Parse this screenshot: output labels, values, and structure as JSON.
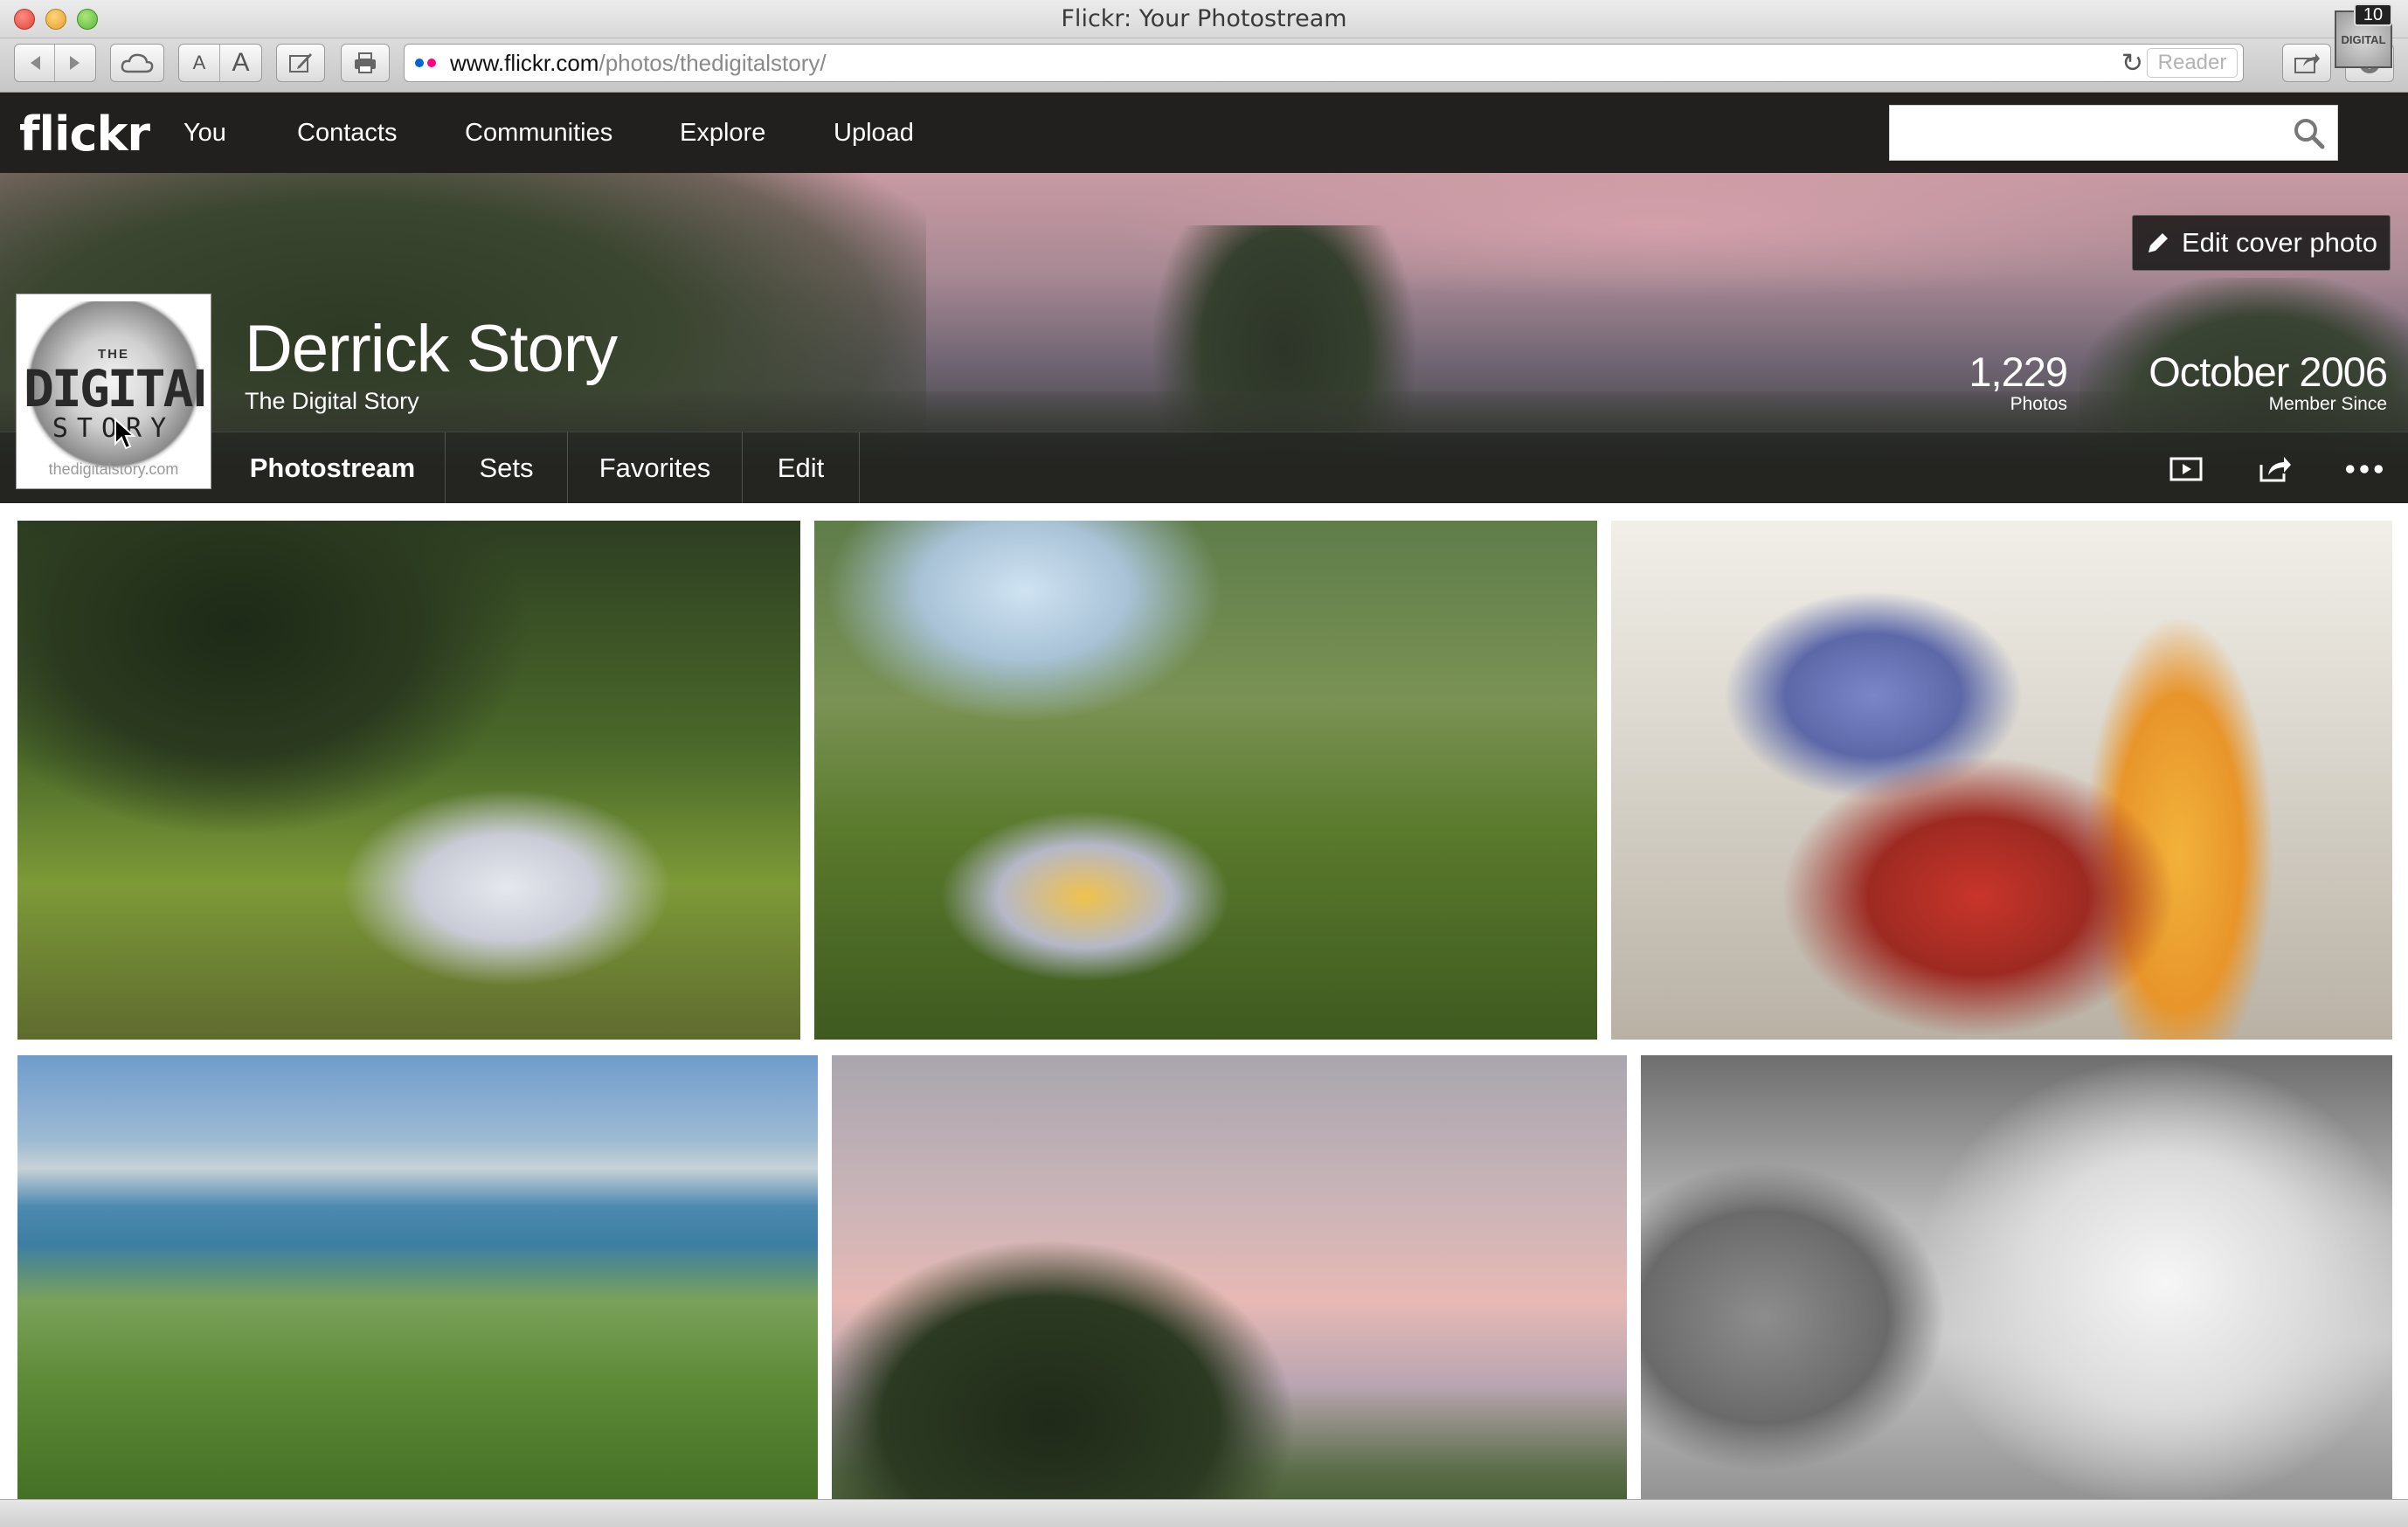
{
  "window": {
    "title": "Flickr: Your Photostream"
  },
  "browser": {
    "url_host": "www.flickr.com",
    "url_path": "/photos/thedigitalstory/",
    "reader_label": "Reader",
    "font_small": "A",
    "font_large": "A"
  },
  "nav": {
    "logo": "flickr",
    "links": [
      "You",
      "Contacts",
      "Communities",
      "Explore",
      "Upload"
    ],
    "search_placeholder": "",
    "notification_count": "10",
    "avatar_text": "DIGITAL"
  },
  "profile": {
    "name": "Derrick Story",
    "subtitle": "The Digital Story",
    "avatar": {
      "the": "THE",
      "digital": "DIGITAL",
      "story": "STORY",
      "url": "thedigitalstory.com"
    },
    "photos_count": "1,229",
    "photos_label": "Photos",
    "member_since": "October 2006",
    "member_since_label": "Member Since",
    "edit_cover_label": "Edit cover photo"
  },
  "subnav": {
    "tabs": [
      "Photostream",
      "Sets",
      "Favorites",
      "Edit"
    ],
    "active": "Photostream"
  },
  "colors": {
    "nav_bg": "#221f1f",
    "flickr_blue": "#0063dc",
    "flickr_pink": "#ff0084"
  }
}
